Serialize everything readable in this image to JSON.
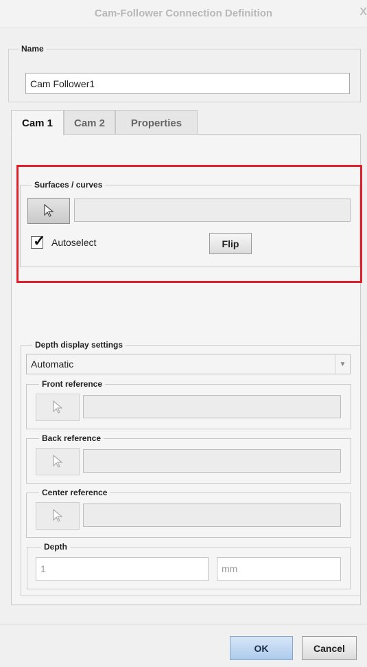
{
  "window": {
    "title": "Cam-Follower Connection Definition",
    "close_glyph": "X"
  },
  "name_group": {
    "legend": "Name",
    "value": "Cam Follower1"
  },
  "tabs": [
    {
      "label": "Cam 1",
      "active": true
    },
    {
      "label": "Cam 2",
      "active": false
    },
    {
      "label": "Properties",
      "active": false
    }
  ],
  "surfaces": {
    "legend": "Surfaces / curves",
    "selector_icon": "cursor-arrow-icon",
    "autoselect_label": "Autoselect",
    "autoselect_checked": true,
    "flip_label": "Flip",
    "highlight_color": "#e0202a"
  },
  "depth_display": {
    "legend": "Depth display settings",
    "mode": "Automatic",
    "front_reference": {
      "legend": "Front reference"
    },
    "back_reference": {
      "legend": "Back reference"
    },
    "center_reference": {
      "legend": "Center reference"
    },
    "depth": {
      "legend": "Depth",
      "value": "1",
      "unit": "mm"
    }
  },
  "footer": {
    "ok_label": "OK",
    "cancel_label": "Cancel"
  }
}
